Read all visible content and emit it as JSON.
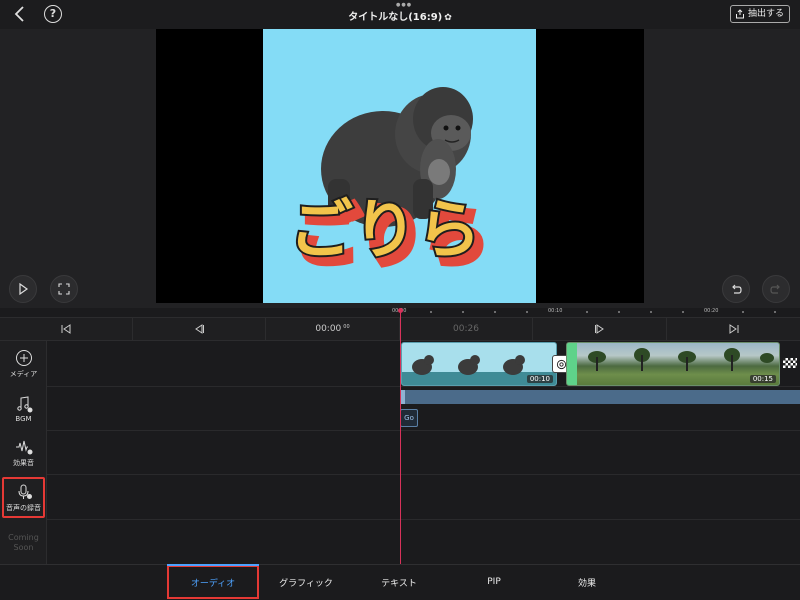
{
  "header": {
    "title": "タイトルなし(16:9)",
    "export_label": "抽出する",
    "icons": [
      "back-chevron-icon",
      "help-icon",
      "gear-icon",
      "export-icon"
    ]
  },
  "preview": {
    "image_text": "ごりら",
    "controls": [
      "play-icon",
      "fullscreen-icon",
      "undo-icon",
      "redo-icon"
    ]
  },
  "ruler": {
    "labels": [
      "00:00",
      "00:10",
      "00:20"
    ]
  },
  "transport": {
    "current_time": "00:00",
    "current_frames": "00",
    "total_time": "00:26",
    "icons": [
      "jump-start-icon",
      "prev-frame-icon",
      "next-frame-icon",
      "jump-end-icon"
    ]
  },
  "tracks": {
    "media": {
      "label": "メディア"
    },
    "bgm": {
      "label": "BGM"
    },
    "sfx": {
      "label": "効果音"
    },
    "voice": {
      "label": "音声の録音"
    },
    "coming_soon": {
      "label": "Coming Soon"
    }
  },
  "timeline": {
    "clip1_duration": "00:10",
    "clip2_duration": "00:15",
    "bgm_chip": "Go"
  },
  "tabs": [
    {
      "label": "オーディオ",
      "active": true
    },
    {
      "label": "グラフィック",
      "active": false
    },
    {
      "label": "テキスト",
      "active": false
    },
    {
      "label": "PIP",
      "active": false
    },
    {
      "label": "効果",
      "active": false
    }
  ],
  "colors": {
    "accent": "#4ea3ff",
    "highlight_box": "#e53935",
    "playhead": "#d7325a",
    "preview_bg": "#84dcf6",
    "bgm_track": "#4b6b8a",
    "logo_yellow": "#f2c44b",
    "logo_red": "#e2493c"
  }
}
